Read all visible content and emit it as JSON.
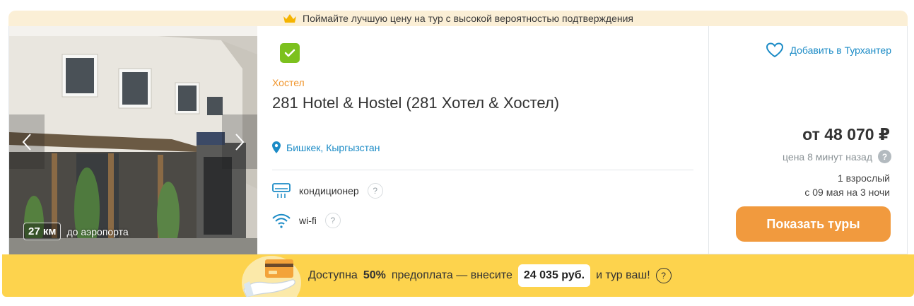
{
  "promo_banner": {
    "icon": "crown-icon",
    "text": "Поймайте лучшую цену на тур с высокой вероятностью подтверждения"
  },
  "photo": {
    "prev_icon": "chevron-left-icon",
    "next_icon": "chevron-right-icon",
    "distance_value": "27 км",
    "distance_label": "до аэропорта"
  },
  "hotel": {
    "verified_icon": "check-badge-icon",
    "type": "Хостел",
    "name": "281 Hotel & Hostel (281 Хотел & Хостел)",
    "location": "Бишкек, Кыргызстан",
    "amenities": [
      {
        "icon": "air-conditioner-icon",
        "label": "кондиционер",
        "help": "?"
      },
      {
        "icon": "wifi-icon",
        "label": "wi-fi",
        "help": "?"
      }
    ]
  },
  "pricing": {
    "favorite_label": "Добавить в Турхантер",
    "price": "от 48 070 ₽",
    "price_age": "цена 8 минут назад",
    "price_help": "?",
    "guests": "1 взрослый",
    "dates": "с 09 мая на 3 ночи",
    "button_label": "Показать туры"
  },
  "prepay": {
    "text_before": "Доступна",
    "percent": "50%",
    "text_middle": "предоплата — внесите",
    "amount": "24 035 руб.",
    "text_after": "и тур ваш!",
    "help": "?"
  },
  "colors": {
    "accent_orange": "#f19a3e",
    "link_blue": "#1b8bc6",
    "verified_green": "#7cc11e",
    "prepay_yellow": "#fdd34d",
    "promo_cream": "#fbefd6"
  }
}
